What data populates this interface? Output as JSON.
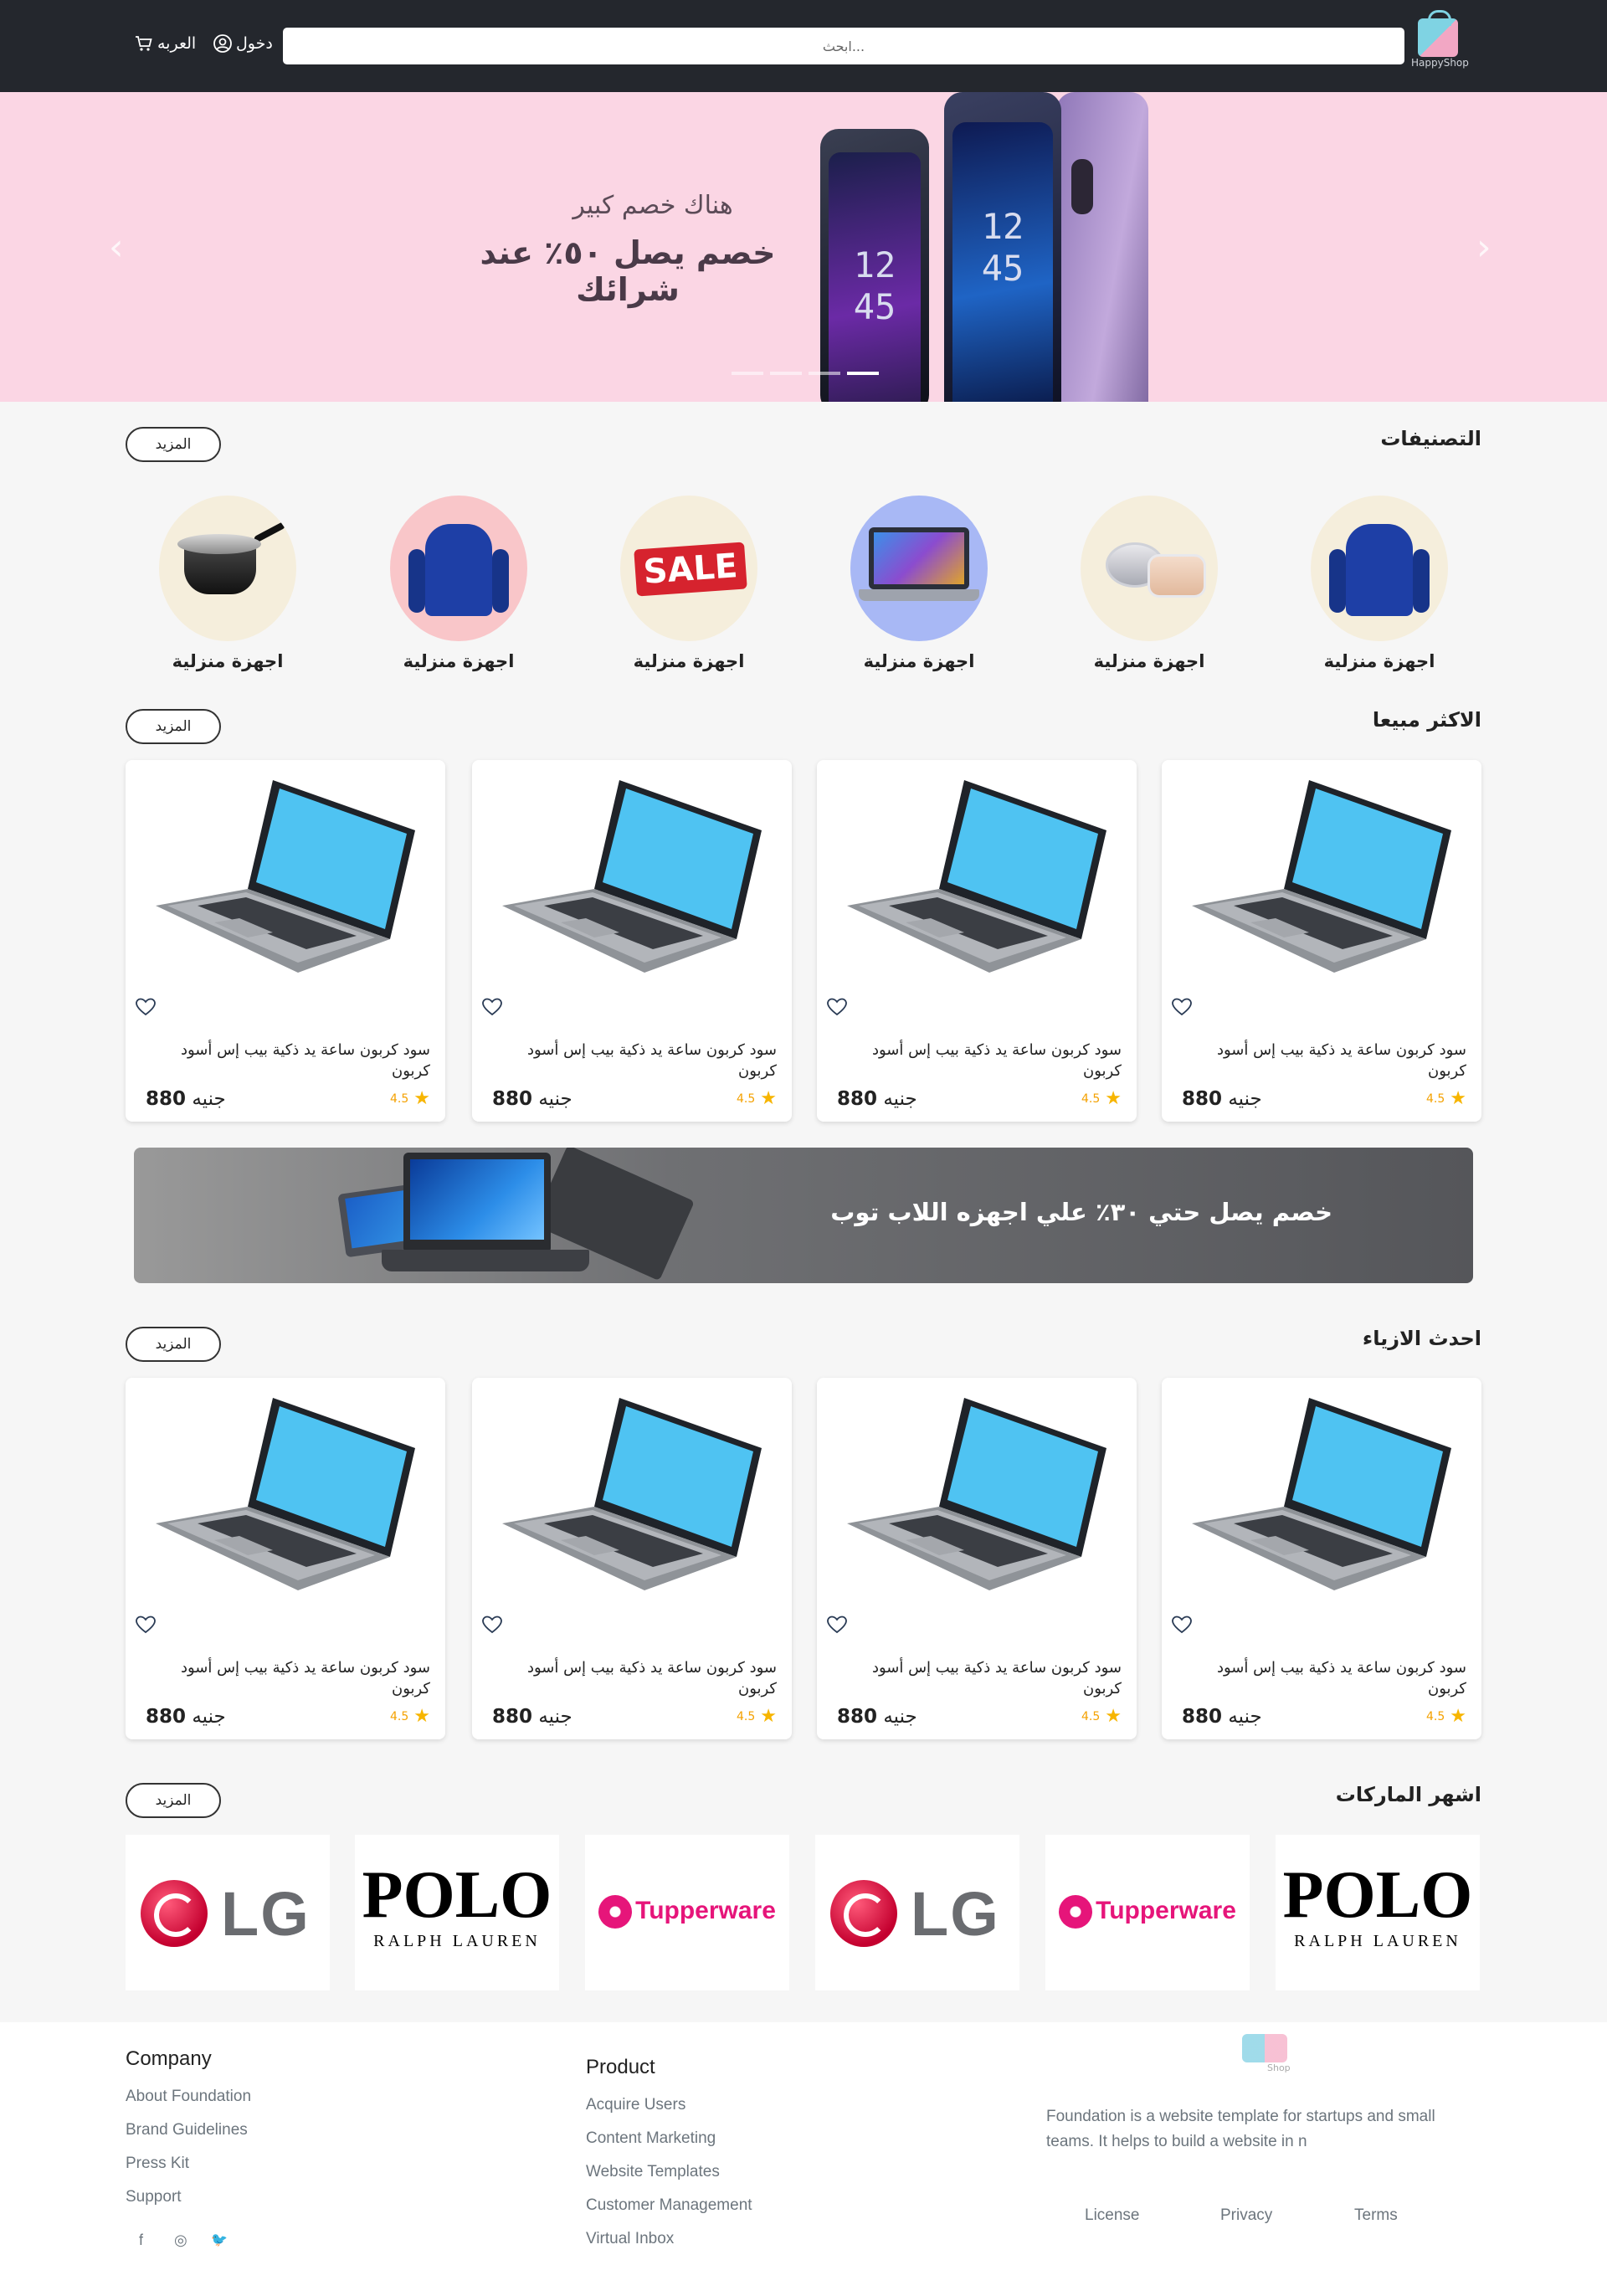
{
  "header": {
    "logo_text": "HappyShop",
    "search_placeholder": "ابحث...",
    "login_label": "دخول",
    "cart_label": "العربه"
  },
  "hero": {
    "subtitle": "هناك خصم كبير",
    "title": "خصم يصل ٥٠٪ عند شرائك",
    "clock_a": "12\n45",
    "clock_b": "12\n45",
    "slides": 4,
    "active_slide": 4
  },
  "categories": {
    "title": "التصنيفات",
    "more_label": "المزيد",
    "items": [
      {
        "label": "اجهزة منزلية",
        "image": "hoodie"
      },
      {
        "label": "اجهزة منزلية",
        "image": "cosmetic-jars"
      },
      {
        "label": "اجهزة منزلية",
        "image": "laptop"
      },
      {
        "label": "اجهزة منزلية",
        "image": "sale-tags"
      },
      {
        "label": "اجهزة منزلية",
        "image": "hoodie"
      },
      {
        "label": "اجهزة منزلية",
        "image": "cooking-pot"
      }
    ]
  },
  "best_sellers": {
    "title": "الاكثر مبيعا",
    "more_label": "المزيد",
    "products": [
      {
        "name": "سود كربون ساعة يد ذكية بيب إس أسود كربون",
        "rating": "4.5",
        "price": "880",
        "currency": "جنيه"
      },
      {
        "name": "سود كربون ساعة يد ذكية بيب إس أسود كربون",
        "rating": "4.5",
        "price": "880",
        "currency": "جنيه"
      },
      {
        "name": "سود كربون ساعة يد ذكية بيب إس أسود كربون",
        "rating": "4.5",
        "price": "880",
        "currency": "جنيه"
      },
      {
        "name": "سود كربون ساعة يد ذكية بيب إس أسود كربون",
        "rating": "4.5",
        "price": "880",
        "currency": "جنيه"
      }
    ]
  },
  "promo": {
    "text": "خصم يصل حتي ٣٠٪ علي اجهزه اللاب توب"
  },
  "newest_fashion": {
    "title": "احدث الازياء",
    "more_label": "المزيد",
    "products": [
      {
        "name": "سود كربون ساعة يد ذكية بيب إس أسود كربون",
        "rating": "4.5",
        "price": "880",
        "currency": "جنيه"
      },
      {
        "name": "سود كربون ساعة يد ذكية بيب إس أسود كربون",
        "rating": "4.5",
        "price": "880",
        "currency": "جنيه"
      },
      {
        "name": "سود كربون ساعة يد ذكية بيب إس أسود كربون",
        "rating": "4.5",
        "price": "880",
        "currency": "جنيه"
      },
      {
        "name": "سود كربون ساعة يد ذكية بيب إس أسود كربون",
        "rating": "4.5",
        "price": "880",
        "currency": "جنيه"
      }
    ]
  },
  "brands": {
    "title": "اشهر الماركات",
    "more_label": "المزيد",
    "items": [
      {
        "name": "POLO",
        "sub": "RALPH LAUREN",
        "type": "polo"
      },
      {
        "name": "Tupperware",
        "type": "tupperware"
      },
      {
        "name": "LG",
        "type": "lg"
      },
      {
        "name": "Tupperware",
        "type": "tupperware"
      },
      {
        "name": "POLO",
        "sub": "RALPH LAUREN",
        "type": "polo"
      },
      {
        "name": "LG",
        "type": "lg"
      }
    ]
  },
  "footer": {
    "company": {
      "title": "Company",
      "links": [
        "About Foundation",
        "Brand Guidelines",
        "Press Kit",
        "Support"
      ]
    },
    "product": {
      "title": "Product",
      "links": [
        "Acquire Users",
        "Content Marketing",
        "Website Templates",
        "Customer Management",
        "Virtual Inbox"
      ]
    },
    "logo_text": "Shop",
    "description": "Foundation is a website template for startups and small teams. It helps to build a website in n",
    "legal": [
      "License",
      "Privacy",
      "Terms"
    ],
    "social": [
      "f",
      "◎",
      "🐦"
    ]
  },
  "colors": {
    "header_bg": "#24272d",
    "hero_bg": "#fbd6e4",
    "rating": "#f7b500",
    "page_bg": "#f6f6f6"
  }
}
